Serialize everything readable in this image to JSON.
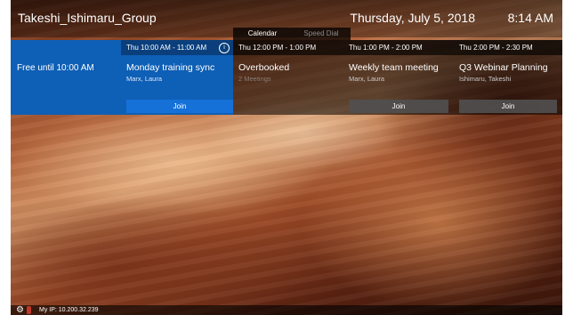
{
  "header": {
    "room_name": "Takeshi_Ishimaru_Group",
    "date": "Thursday, July 5, 2018",
    "time": "8:14 AM"
  },
  "tabs": [
    {
      "label": "Calendar",
      "active": true
    },
    {
      "label": "Speed Dial",
      "active": false
    }
  ],
  "free_panel": {
    "label": "Free until 10:00 AM"
  },
  "meetings": [
    {
      "time": "Thu 10:00 AM - 11:00 AM",
      "title": "Monday training sync",
      "subtitle": "Marx, Laura",
      "join": "Join",
      "current": true
    },
    {
      "time": "Thu 12:00 PM - 1:00 PM",
      "title": "Overbooked",
      "subtitle": "2 Meetings",
      "join": null
    },
    {
      "time": "Thu 1:00 PM - 2:00 PM",
      "title": "Weekly team meeting",
      "subtitle": "Marx, Laura",
      "join": "Join"
    },
    {
      "time": "Thu 2:00 PM - 2:30 PM",
      "title": "Q3 Webinar Planning",
      "subtitle": "Ishimaru, Takeshi",
      "join": "Join"
    }
  ],
  "footer": {
    "ip": "My IP: 10.200.32.239"
  },
  "icons": {
    "info": "info-icon",
    "settings": "gear-icon",
    "mic": "mic-muted-icon"
  },
  "colors": {
    "accent": "#0e5fb6",
    "join_active": "#1571d8"
  }
}
